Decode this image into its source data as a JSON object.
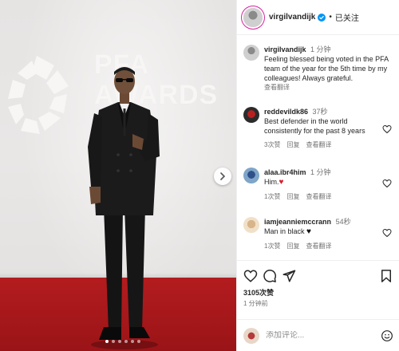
{
  "media": {
    "backdrop_logo_lines": [
      "PFA",
      "AWARDS"
    ],
    "carousel_dots": 6,
    "active_dot": 0
  },
  "post": {
    "username": "virgilvandijk",
    "follow_state": "已关注",
    "separator": "•",
    "caption": {
      "username": "virgilvandijk",
      "time": "1 分钟",
      "text": "Feeling blessed being voted in the PFA team of the year for the 5th time by my colleagues! Always grateful.",
      "translate": "查看翻译"
    },
    "comments": [
      {
        "username": "reddevildk86",
        "time": "37秒",
        "text": "Best defender in the world consistently for the past 8 years",
        "likes": "3次赞",
        "reply": "回复",
        "translate": "查看翻译"
      },
      {
        "username": "alaa.ibr4him",
        "time": "1 分钟",
        "text": "Him.",
        "emoji": "♥",
        "likes": "1次赞",
        "reply": "回复",
        "translate": "查看翻译"
      },
      {
        "username": "iamjeanniemccrann",
        "time": "54秒",
        "text": "Man in black",
        "emoji": "♥",
        "likes": "1次赞",
        "reply": "回复",
        "translate": "查看翻译"
      }
    ],
    "like_count": "3105次赞",
    "posted_time": "1 分钟前",
    "composer_placeholder": "添加评论..."
  },
  "colors": {
    "verified_blue": "#0095f6",
    "carpet_red": "#b31c1f",
    "story_ring": "#d6249f"
  },
  "icons": [
    "verified-badge-icon",
    "chevron-right-icon",
    "heart-icon",
    "comment-icon",
    "share-icon",
    "bookmark-icon",
    "emoji-icon"
  ]
}
